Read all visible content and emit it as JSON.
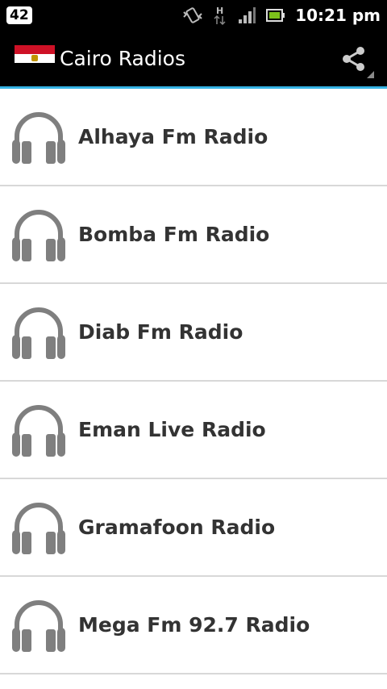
{
  "status_bar": {
    "notification_count": "42",
    "time": "10:21 pm",
    "network_label": "H",
    "icons": [
      "vibrate-icon",
      "network-h-icon",
      "signal-icon",
      "battery-icon"
    ]
  },
  "action_bar": {
    "title": "Cairo Radios",
    "flag": "egypt-flag",
    "share_icon": "share-icon",
    "accent_color": "#35b3e5"
  },
  "stations": [
    {
      "name": "Alhaya Fm Radio"
    },
    {
      "name": "Bomba Fm Radio"
    },
    {
      "name": "Diab Fm Radio"
    },
    {
      "name": "Eman Live Radio"
    },
    {
      "name": "Gramafoon Radio"
    },
    {
      "name": "Mega Fm 92.7 Radio"
    }
  ]
}
